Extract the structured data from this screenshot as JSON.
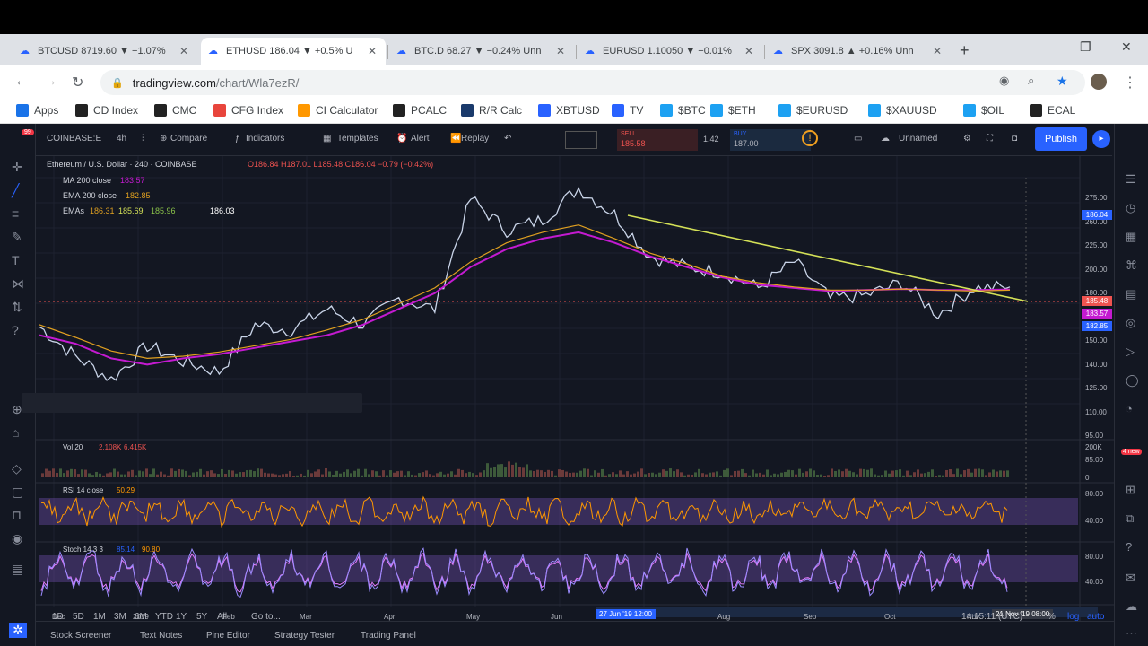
{
  "tabs": [
    {
      "label": "BTCUSD 8719.60 ▼ −1.07%"
    },
    {
      "label": "ETHUSD 186.04 ▼ +0.5% U"
    },
    {
      "label": "BTC.D 68.27 ▼ −0.24% Unn"
    },
    {
      "label": "EURUSD 1.10050 ▼ −0.01%"
    },
    {
      "label": "SPX 3091.8 ▲ +0.16% Unn"
    }
  ],
  "address": {
    "domain": "tradingview.com",
    "path": "/chart/Wla7ezR/"
  },
  "bookmarks": [
    "Apps",
    "CD Index",
    "CMC",
    "CFG Index",
    "CI Calculator",
    "PCALC",
    "R/R Calc",
    "XBTUSD",
    "TV",
    "$BTC",
    "$ETH",
    "$EURUSD",
    "$XAUUSD",
    "$OIL",
    "ECAL"
  ],
  "toolbar": {
    "symbol": "COINBASE:E",
    "interval": "4h",
    "compare": "Compare",
    "indicators": "Indicators",
    "templates": "Templates",
    "alert": "Alert",
    "replay": "Replay",
    "sell_label": "SELL",
    "sell_price": "185.58",
    "spread": "1.42",
    "buy_label": "BUY",
    "buy_price": "187.00",
    "layout": "Unnamed",
    "publish": "Publish"
  },
  "legend": {
    "title": "Ethereum / U.S. Dollar · 240 · COINBASE",
    "ohlc": "O186.84 H187.01 L185.48 C186.04 −0.79 (−0.42%)",
    "ma": "MA 200 close",
    "ma_val": "183.57",
    "ema": "EMA 200 close",
    "ema_val": "182.85",
    "emas": "EMAs",
    "emas_vals": [
      "186.31",
      "185.69",
      "185.96",
      "186.03"
    ]
  },
  "price_axis": [
    "275.00",
    "260.00",
    "225.00",
    "200.00",
    "180.00",
    "165.00",
    "150.00",
    "140.00",
    "125.00",
    "110.00",
    "95.00",
    "85.00"
  ],
  "price_tags": [
    "186.04",
    "185.48",
    "183.57",
    "182.85"
  ],
  "indicators": {
    "vol": {
      "label": "Vol 20",
      "v1": "2.108K",
      "v2": "6.415K",
      "axis": [
        "200K",
        "0"
      ]
    },
    "rsi": {
      "label": "RSI 14 close",
      "value": "50.29",
      "axis": [
        "80.00",
        "40.00"
      ]
    },
    "stoch": {
      "label": "Stoch 14 3 3",
      "v1": "85.14",
      "v2": "90.80",
      "axis": [
        "80.00",
        "40.00"
      ]
    }
  },
  "time_axis": [
    "Dec",
    "2019",
    "Feb",
    "Mar",
    "Apr",
    "May",
    "Jun",
    "Aug",
    "Sep",
    "Oct",
    "Nov"
  ],
  "time_highlights": [
    "27 Jun '19 12:00",
    "21 Nov '19 08:00"
  ],
  "ranges": [
    "1D",
    "5D",
    "1M",
    "3M",
    "6M",
    "YTD",
    "1Y",
    "5Y",
    "All"
  ],
  "goto": "Go to...",
  "clock": "14:15:11 (UTC)",
  "pct": "%",
  "log": "log",
  "auto": "auto",
  "bottom_tabs": [
    "Stock Screener",
    "Text Notes",
    "Pine Editor",
    "Strategy Tester",
    "Trading Panel"
  ],
  "notif_badge": "99",
  "right_badge": "4 new",
  "colors": {
    "bg": "#131722",
    "accent": "#2962ff",
    "ma": "#c41ad1",
    "ema": "#e0a020",
    "trend": "#d4e157",
    "rsi": "#ff9800",
    "stoch": "#e57cff",
    "sell": "#ef5350",
    "buy": "#26a69a"
  },
  "chart_data": {
    "type": "line",
    "series": [
      {
        "name": "",
        "values": [
          148,
          120,
          98,
          130,
          115,
          105,
          150,
          145,
          165,
          150,
          175,
          165,
          270,
          240,
          250,
          280,
          255,
          215,
          205,
          200,
          185,
          210,
          175,
          178,
          190,
          160,
          185,
          186
        ]
      },
      {
        "name": "MA 200 close",
        "values": [
          140,
          132,
          118,
          112,
          118,
          122,
          128,
          134,
          140,
          150,
          165,
          180,
          205,
          222,
          232,
          238,
          228,
          215,
          205,
          195,
          188,
          185,
          182,
          183,
          184,
          183,
          183,
          183.57
        ]
      },
      {
        "name": "EMA 200 close",
        "values": [
          150,
          138,
          125,
          118,
          120,
          124,
          130,
          136,
          145,
          155,
          170,
          185,
          210,
          228,
          238,
          245,
          232,
          218,
          208,
          196,
          190,
          186,
          183,
          183,
          184,
          183,
          182,
          182.85
        ]
      }
    ],
    "ylim": [
      85,
      290
    ],
    "title": "Ethereum / U.S. Dollar · 240 · COINBASE"
  }
}
